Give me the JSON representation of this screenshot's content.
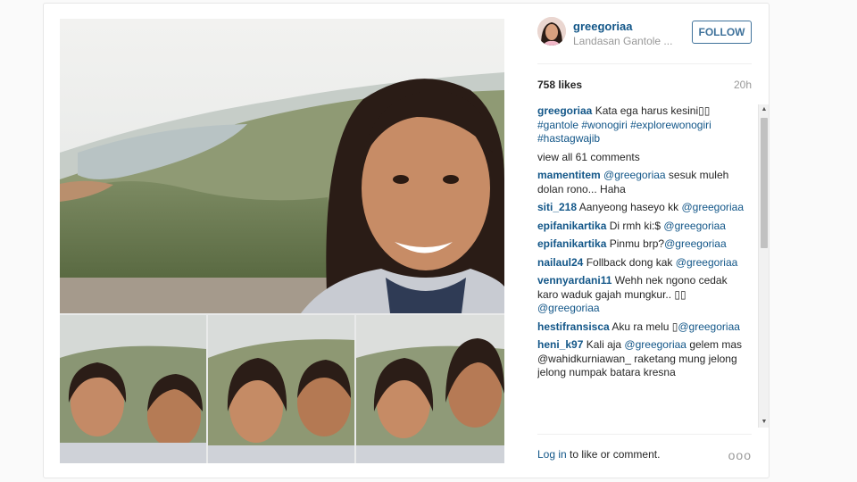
{
  "post": {
    "username": "greegoriaa",
    "location": "Landasan Gantole ...",
    "follow_label": "FOLLOW",
    "likes": "758 likes",
    "age": "20h"
  },
  "caption": {
    "user": "greegoriaa",
    "text": "Kata ega harus kesini",
    "emoji": "▯▯",
    "hashtags": "#gantole #wonogiri #explorewonogiri #hastagwajib"
  },
  "view_all": "view all 61 comments",
  "comments": [
    {
      "user": "mamentitem",
      "pre": "",
      "mention": "@greegoriaa",
      "post": " sesuk muleh dolan rono... Haha"
    },
    {
      "user": "siti_218",
      "pre": "Aanyeong haseyo kk ",
      "mention": "@greegoriaa",
      "post": ""
    },
    {
      "user": "epifanikartika",
      "pre": "Di rmh ki:$ ",
      "mention": "@greegoriaa",
      "post": ""
    },
    {
      "user": "epifanikartika",
      "pre": "Pinmu brp?",
      "mention": "@greegoriaa",
      "post": ""
    },
    {
      "user": "nailaul24",
      "pre": "Follback dong kak ",
      "mention": "@greegoriaa",
      "post": ""
    },
    {
      "user": "vennyardani11",
      "pre": "Wehh nek ngono cedak karo waduk gajah mungkur.. ▯▯ ",
      "mention": "@greegoriaa",
      "post": ""
    },
    {
      "user": "hestifransisca",
      "pre": "Aku ra melu ▯",
      "mention": "@greegoriaa",
      "post": ""
    },
    {
      "user": "heni_k97",
      "pre": "Kali aja ",
      "mention": "@greegoriaa",
      "post": " gelem mas @wahidkurniawan_ raketang mung jelong jelong numpak batara kresna"
    }
  ],
  "footer": {
    "login": "Log in",
    "rest": " to like or comment.",
    "more": "ooo"
  },
  "colors": {
    "link": "#125688",
    "follow_border": "#3f729b",
    "muted": "#999999"
  },
  "icons": {
    "more": "more-options-icon",
    "scroll_up": "scroll-up-icon",
    "scroll_down": "scroll-down-icon"
  }
}
